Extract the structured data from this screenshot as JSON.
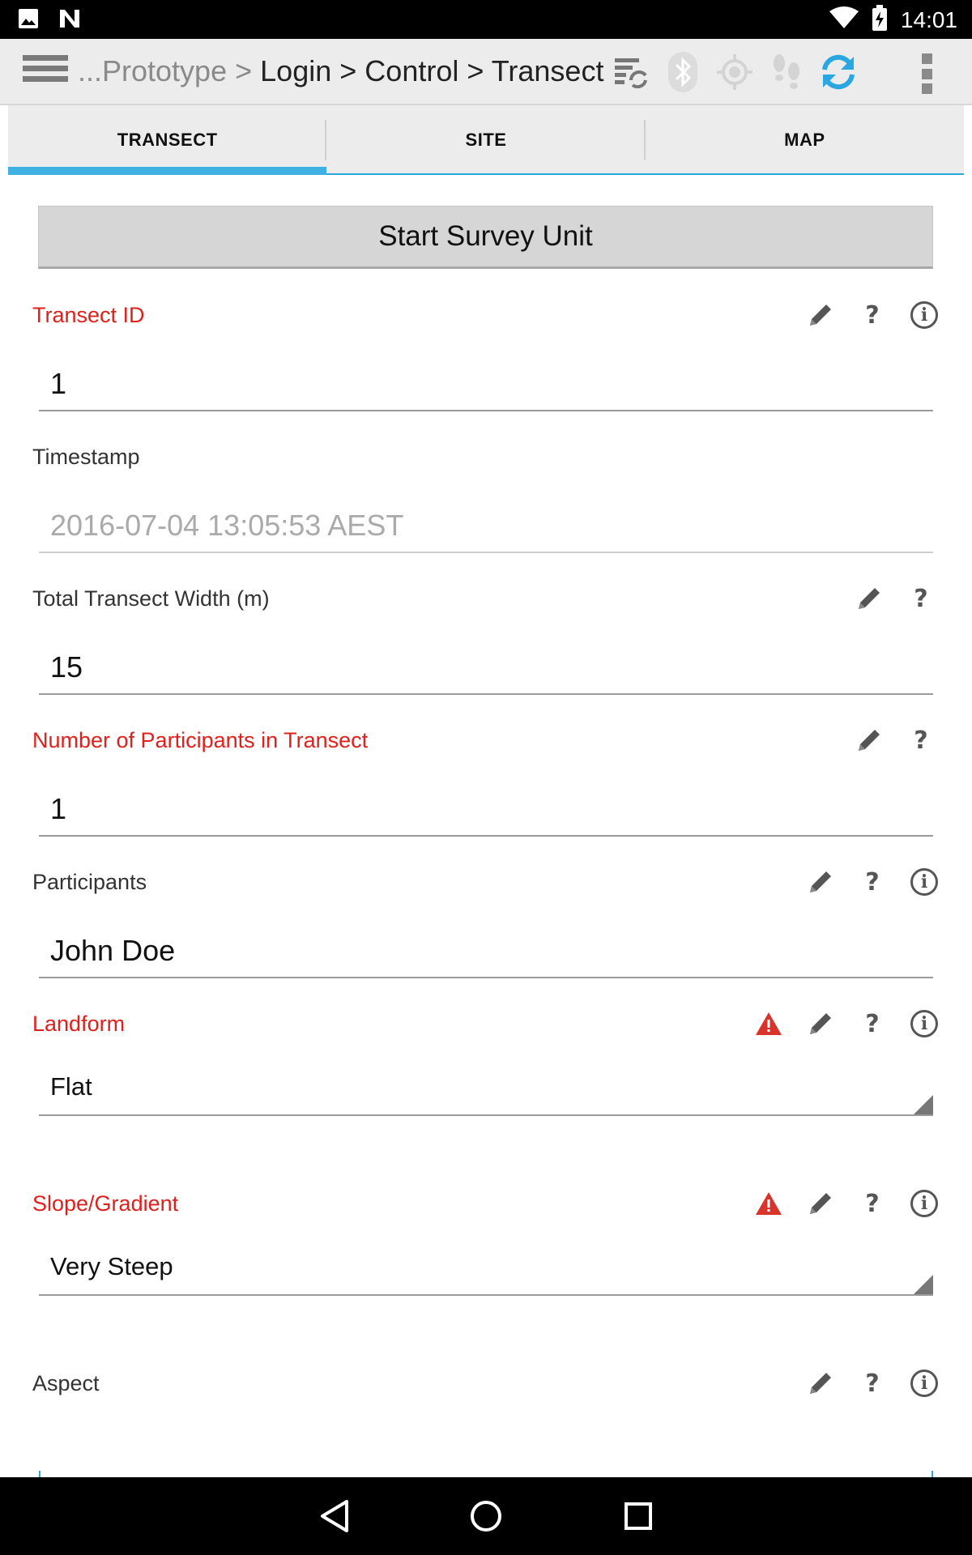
{
  "status_bar": {
    "time": "14:01"
  },
  "toolbar": {
    "breadcrumb": [
      {
        "label": "...Prototype",
        "muted": true
      },
      {
        "label": "Login",
        "muted": false
      },
      {
        "label": "Control",
        "muted": false
      },
      {
        "label": "Transect",
        "muted": false
      }
    ],
    "separator": ">",
    "icons": [
      "sync-list-icon",
      "bluetooth-icon",
      "gps-icon",
      "tracking-icon",
      "refresh-icon"
    ]
  },
  "tabs": [
    {
      "label": "TRANSECT",
      "active": true
    },
    {
      "label": "SITE",
      "active": false
    },
    {
      "label": "MAP",
      "active": false
    }
  ],
  "form": {
    "start_button": "Start Survey Unit",
    "transect_id": {
      "label": "Transect ID",
      "value": "1",
      "required": true
    },
    "timestamp": {
      "label": "Timestamp",
      "value": "2016-07-04 13:05:53 AEST",
      "readonly": true
    },
    "transect_width": {
      "label": "Total Transect Width (m)",
      "value": "15"
    },
    "participants_count": {
      "label": "Number of Participants in Transect",
      "value": "1",
      "required": true
    },
    "participants": {
      "label": "Participants",
      "value": "John Doe"
    },
    "landform": {
      "label": "Landform",
      "value": "Flat",
      "required": true,
      "warning": true
    },
    "slope": {
      "label": "Slope/Gradient",
      "value": "Very Steep",
      "required": true,
      "warning": true
    },
    "aspect": {
      "label": "Aspect",
      "value": ""
    }
  },
  "colors": {
    "accent": "#3fb2e3",
    "required": "#e0201c",
    "warning": "#d9342b"
  }
}
